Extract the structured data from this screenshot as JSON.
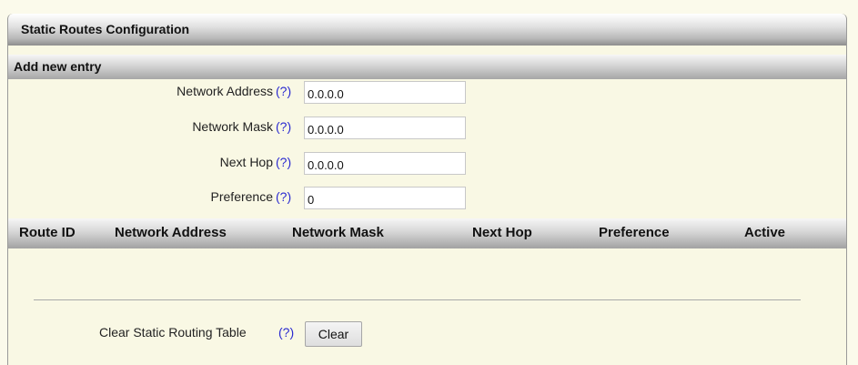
{
  "panel": {
    "title": "Static Routes Configuration",
    "section_title": "Add new entry"
  },
  "form": {
    "network_address": {
      "label": "Network Address",
      "help": "(?)",
      "value": "0.0.0.0"
    },
    "network_mask": {
      "label": "Network Mask",
      "help": "(?)",
      "value": "0.0.0.0"
    },
    "next_hop": {
      "label": "Next Hop",
      "help": "(?)",
      "value": "0.0.0.0"
    },
    "preference": {
      "label": "Preference",
      "help": "(?)",
      "value": "0"
    }
  },
  "table": {
    "columns": [
      "Route ID",
      "Network Address",
      "Network Mask",
      "Next Hop",
      "Preference",
      "Active"
    ],
    "rows": []
  },
  "clear_section": {
    "label": "Clear Static Routing Table",
    "help": "(?)",
    "button_label": "Clear"
  },
  "colors": {
    "page_background": "#fbfaeb",
    "help_link": "#2a2ad0"
  }
}
